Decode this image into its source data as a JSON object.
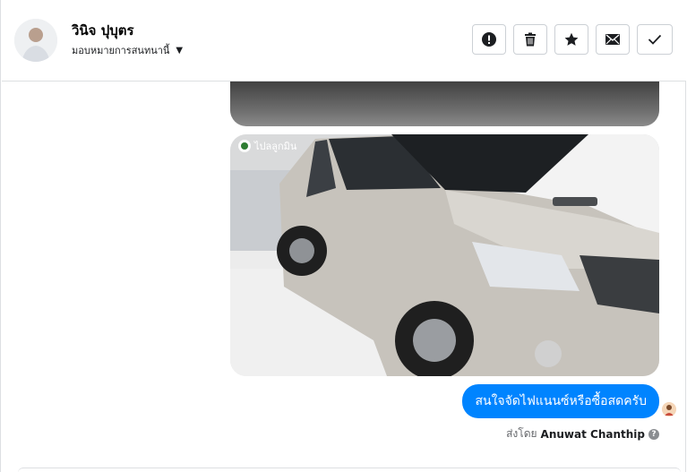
{
  "header": {
    "contact_name": "วินิจ ปุบุตร",
    "assign_label": "มอบหมายการสนทนานี้",
    "actions": [
      {
        "name": "report-spam-button",
        "icon": "exclamation-circle-icon"
      },
      {
        "name": "delete-button",
        "icon": "trash-icon"
      },
      {
        "name": "star-button",
        "icon": "star-icon"
      },
      {
        "name": "mark-unread-button",
        "icon": "envelope-icon"
      },
      {
        "name": "mark-done-button",
        "icon": "check-icon"
      }
    ]
  },
  "thread": {
    "image_watermark": "ไปลลูกมิน",
    "message_text": "สนใจจัดไฟแนนซ์หรือซื้อสดครับ",
    "sent_by_prefix": "ส่งโดย",
    "sent_by_name": "Anuwat Chanthip",
    "help_symbol": "?"
  },
  "colors": {
    "accent": "#0084ff",
    "border": "#dddfe2",
    "muted_text": "#65676b"
  }
}
